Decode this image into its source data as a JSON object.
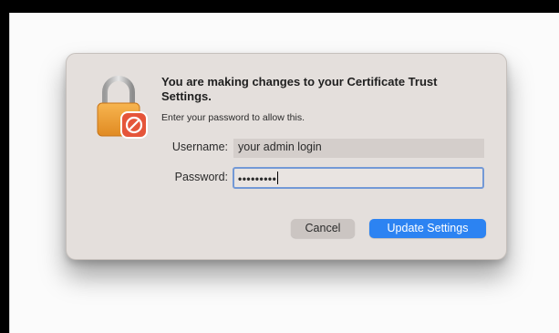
{
  "dialog": {
    "title": "You are making changes to your Certificate Trust Settings.",
    "subtitle": "Enter your password to allow this.",
    "username_label": "Username:",
    "username_value": "your admin login",
    "password_label": "Password:",
    "password_value": "•••••••••",
    "cancel_label": "Cancel",
    "update_label": "Update Settings"
  },
  "colors": {
    "dialog_background": "#e4dfdc",
    "accent_blue": "#2c83f2",
    "focus_ring": "#7399d6",
    "lock_body": "#f2a33a",
    "badge_red": "#e5553a"
  },
  "icons": {
    "lock": "lock-icon",
    "badge": "no-entry-badge-icon"
  }
}
